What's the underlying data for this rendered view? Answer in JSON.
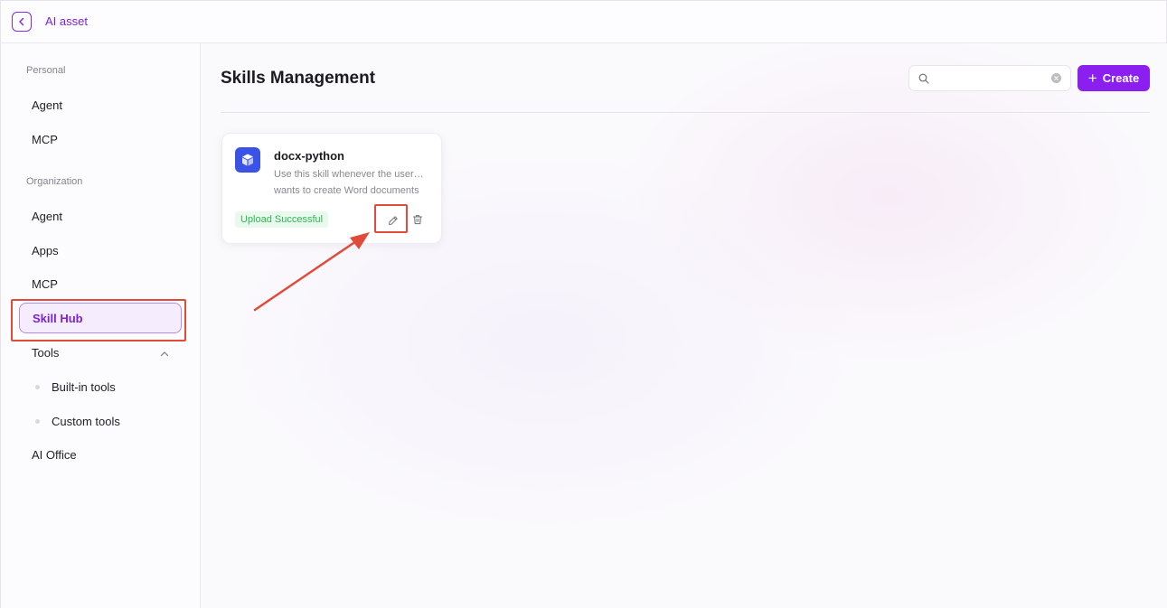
{
  "header": {
    "breadcrumb": "AI asset"
  },
  "sidebar": {
    "personal_label": "Personal",
    "personal_items": [
      {
        "label": "Agent"
      },
      {
        "label": "MCP"
      }
    ],
    "organization_label": "Organization",
    "organization_items": [
      {
        "label": "Agent"
      },
      {
        "label": "Apps"
      },
      {
        "label": "MCP"
      },
      {
        "label": "Skill Hub",
        "active": true
      },
      {
        "label": "Tools",
        "expanded": true
      }
    ],
    "tools_children": [
      {
        "label": "Built-in tools"
      },
      {
        "label": "Custom tools"
      }
    ],
    "last_item": {
      "label": "AI Office"
    }
  },
  "main": {
    "title": "Skills Management",
    "search": {
      "value": "",
      "placeholder": ""
    },
    "create_label": "Create"
  },
  "skills": [
    {
      "name": "docx-python",
      "description_line1": "Use this skill whenever the user…",
      "description_line2": "wants to create Word documents",
      "status": "Upload Successful"
    }
  ],
  "colors": {
    "accent": "#8a1ff0",
    "annotation": "#e04b3a",
    "status_success": "#2fb653",
    "skill_icon": "#3a52e5"
  },
  "icons": {
    "back": "chevron-left-icon",
    "search": "search-icon",
    "clear": "clear-icon",
    "create": "plus-icon",
    "skill": "cube-icon",
    "edit": "pencil-icon",
    "delete": "trash-icon",
    "tools_toggle": "chevron-up-icon"
  }
}
